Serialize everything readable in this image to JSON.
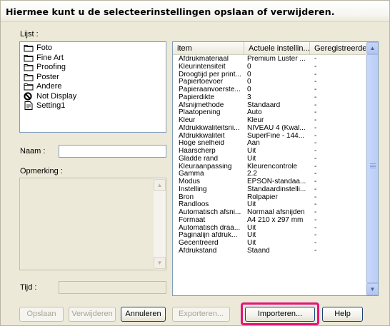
{
  "title": "Hiermee kunt u de selecteerinstellingen opslaan of verwijderen.",
  "list_label": "Lijst :",
  "list_items": [
    {
      "label": "Foto",
      "icon": "folder-icon"
    },
    {
      "label": "Fine Art",
      "icon": "folder-icon"
    },
    {
      "label": "Proofing",
      "icon": "folder-icon"
    },
    {
      "label": "Poster",
      "icon": "folder-icon"
    },
    {
      "label": "Andere",
      "icon": "folder-icon"
    },
    {
      "label": "Not Display",
      "icon": "prohibited-icon"
    },
    {
      "label": "Setting1",
      "icon": "settings-file-icon"
    }
  ],
  "name_label": "Naam :",
  "name_value": "",
  "remark_label": "Opmerking :",
  "time_label": "Tijd :",
  "time_value": "",
  "table": {
    "headers": [
      "item",
      "Actuele instellin...",
      "Geregistreerde ..."
    ],
    "rows": [
      [
        "Afdrukmateriaal",
        "Premium Luster ...",
        "-"
      ],
      [
        "Kleurintensiteit",
        "0",
        "-"
      ],
      [
        "Droogtijd per print...",
        "0",
        "-"
      ],
      [
        "Papiertoevoer",
        "0",
        "-"
      ],
      [
        "Papieraanvoerste...",
        "0",
        "-"
      ],
      [
        "Papierdikte",
        "3",
        "-"
      ],
      [
        "Afsnijmethode",
        "Standaard",
        "-"
      ],
      [
        "Plaatopening",
        "Auto",
        "-"
      ],
      [
        "Kleur",
        "Kleur",
        "-"
      ],
      [
        "Afdrukkwaliteitsni...",
        "NIVEAU 4 (Kwal...",
        "-"
      ],
      [
        "Afdrukkwaliteit",
        "SuperFine - 144...",
        "-"
      ],
      [
        "Hoge snelheid",
        "Aan",
        "-"
      ],
      [
        "Haarscherp",
        "Uit",
        "-"
      ],
      [
        "Gladde rand",
        "Uit",
        "-"
      ],
      [
        "Kleuraanpassing",
        "Kleurencontrole",
        "-"
      ],
      [
        "Gamma",
        "2.2",
        "-"
      ],
      [
        "Modus",
        "EPSON-standaa...",
        "-"
      ],
      [
        "Instelling",
        "Standaardinstelli...",
        "-"
      ],
      [
        "Bron",
        "Rolpapier",
        "-"
      ],
      [
        "Randloos",
        "Uit",
        "-"
      ],
      [
        "Automatisch afsni...",
        "Normaal afsnijden",
        "-"
      ],
      [
        "Formaat",
        "A4 210 x 297 mm",
        "-"
      ],
      [
        "Automatisch draa...",
        "Uit",
        "-"
      ],
      [
        "Paginalijn afdruk...",
        "Uit",
        "-"
      ],
      [
        "Gecentreerd",
        "Uit",
        "-"
      ],
      [
        "Afdrukstand",
        "Staand",
        "-"
      ]
    ]
  },
  "buttons": {
    "save": "Opslaan",
    "delete": "Verwijderen",
    "cancel": "Annuleren",
    "export": "Exporteren...",
    "import": "Importeren...",
    "help": "Help"
  },
  "colors": {
    "highlight": "#e5147c",
    "dialog_bg": "#ece9d8",
    "border_blue": "#7f9db9"
  }
}
